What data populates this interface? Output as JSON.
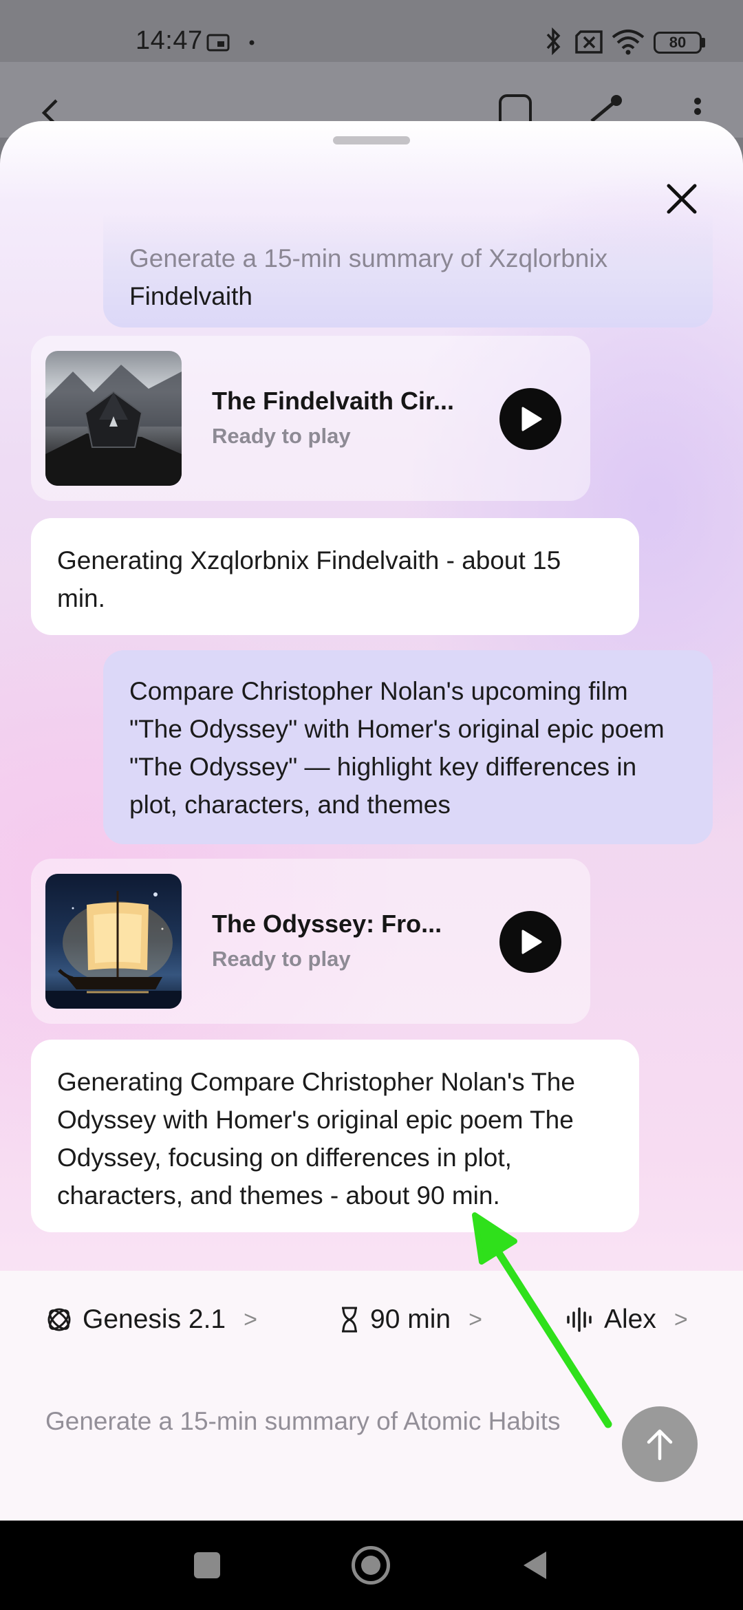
{
  "status_bar": {
    "time": "14:47",
    "battery": "80",
    "icons": [
      "screen-record-icon",
      "dot-icon",
      "bluetooth-icon",
      "no-sim-icon",
      "wifi-icon",
      "battery-icon"
    ]
  },
  "app_header": {
    "icons": [
      "back-arrow-icon",
      "bookmark-icon",
      "share-icon",
      "more-vert-icon"
    ]
  },
  "sheet": {
    "close_icon": "close-icon",
    "messages": [
      {
        "role": "user",
        "text_faded": "Generate a 15-min summary of Xzqlorbnix",
        "text": "Findelvaith"
      },
      {
        "role": "card",
        "title": "The Findelvaith Cir...",
        "status": "Ready to play",
        "image": "dark-crystal-mountain-thumbnail"
      },
      {
        "role": "assistant",
        "text": "Generating Xzqlorbnix Findelvaith - about 15 min."
      },
      {
        "role": "user",
        "text": "Compare Christopher Nolan's upcoming film \"The Odyssey\" with Homer's original epic poem \"The Odyssey\" — highlight key differences in plot, characters, and themes"
      },
      {
        "role": "card",
        "title": "The Odyssey: Fro...",
        "status": "Ready to play",
        "image": "sailing-ship-night-thumbnail"
      },
      {
        "role": "assistant",
        "text": "Generating Compare Christopher Nolan's The Odyssey with Homer's original epic poem The Odyssey, focusing on differences in plot, characters, and themes - about 90 min."
      }
    ]
  },
  "options": {
    "model": {
      "label": "Genesis 2.1",
      "icon": "atom-icon"
    },
    "duration": {
      "label": "90 min",
      "icon": "hourglass-icon"
    },
    "voice": {
      "label": "Alex",
      "icon": "voice-wave-icon"
    },
    "chevron": ">"
  },
  "composer": {
    "placeholder": "Generate a 15-min summary of Atomic Habits",
    "send_icon": "arrow-up-icon"
  },
  "nav_bar": {
    "icons": [
      "recents-square-icon",
      "home-circle-icon",
      "back-triangle-icon"
    ]
  },
  "colors": {
    "user_bubble": "#dcd8f8",
    "assistant_bubble": "#ffffff",
    "play_button": "#0c0c0c",
    "send_button": "#9a9a9a",
    "annotation_arrow": "#2fe01b"
  }
}
